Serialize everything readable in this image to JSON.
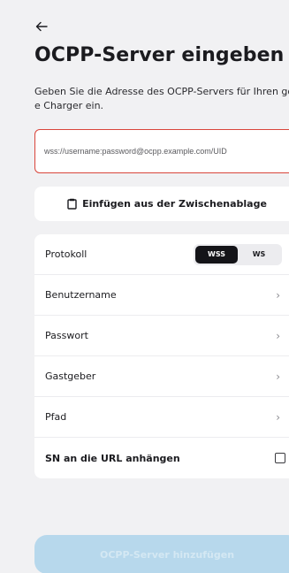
{
  "header": {
    "back_icon": "arrow-left-icon",
    "title": "OCPP-Server eingeben",
    "description": "Geben Sie die Adresse des OCPP-Servers für Ihren go-e Charger ein."
  },
  "url_input": {
    "placeholder": "wss://username:password@ocpp.example.com/UID",
    "value": ""
  },
  "paste_button": {
    "icon": "clipboard-icon",
    "label": "Einfügen aus der Zwischenablage"
  },
  "settings": {
    "protocol": {
      "label": "Protokoll",
      "options": [
        "WSS",
        "WS"
      ],
      "selected": "WSS"
    },
    "username_label": "Benutzername",
    "password_label": "Passwort",
    "host_label": "Gastgeber",
    "path_label": "Pfad",
    "append_sn": {
      "label": "SN an die URL anhängen",
      "checked": false
    }
  },
  "submit_button": {
    "label": "OCPP-Server hinzufügen"
  },
  "colors": {
    "error_border": "#d9453b",
    "submit_disabled": "#b7d8ec",
    "segment_active": "#141418"
  }
}
